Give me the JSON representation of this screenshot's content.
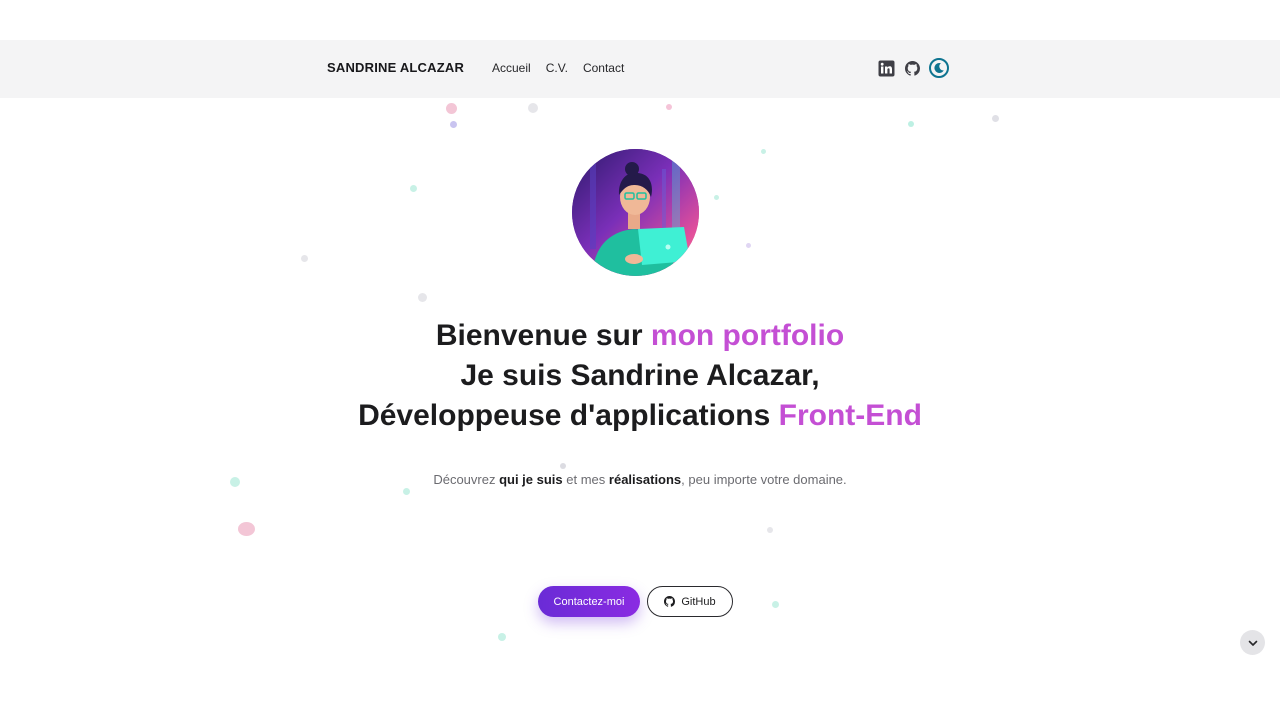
{
  "header": {
    "brand": "SANDRINE ALCAZAR",
    "nav": [
      {
        "label": "Accueil"
      },
      {
        "label": "C.V."
      },
      {
        "label": "Contact"
      }
    ],
    "social_icons": [
      "linkedin-icon",
      "github-icon",
      "theme-toggle-icon"
    ]
  },
  "hero": {
    "line1_prefix": "Bienvenue sur ",
    "line1_accent": "mon portfolio",
    "line2": "Je suis Sandrine Alcazar,",
    "line3_prefix": "Développeuse d'applications ",
    "line3_accent": "Front-End",
    "subtitle_part1": "Découvrez ",
    "subtitle_bold1": "qui je suis",
    "subtitle_part2": " et mes ",
    "subtitle_bold2": "réalisations",
    "subtitle_part3": ", peu importe votre domaine."
  },
  "buttons": {
    "contact_label": "Contactez-moi",
    "github_label": "GitHub"
  },
  "colors": {
    "accent": "#c44fd4",
    "primary_button": "#7a2be0",
    "header_bg": "#f4f4f5"
  }
}
